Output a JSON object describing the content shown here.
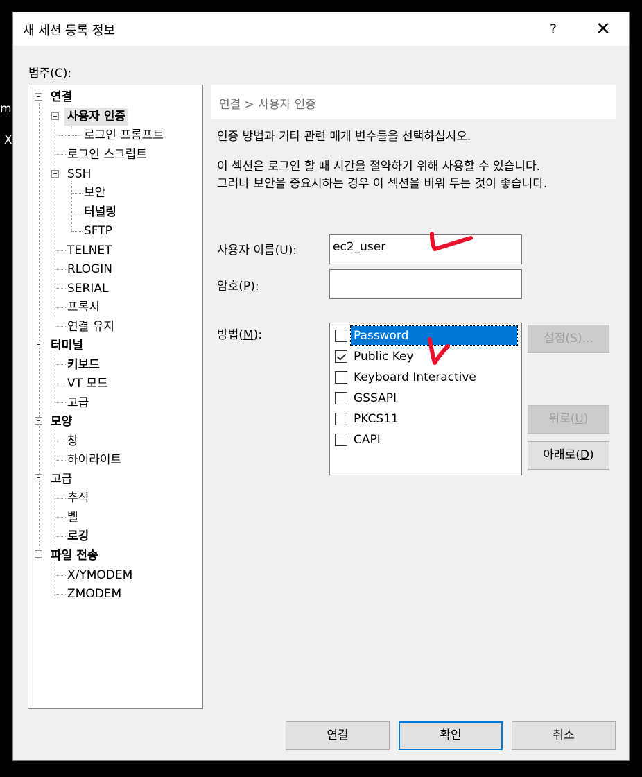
{
  "background": {
    "frag1": "mp",
    "frag2": "X"
  },
  "titlebar": {
    "title": "새 세션 등록 정보",
    "help": "?",
    "close": "✕"
  },
  "category": {
    "label_pre": "범주(",
    "mnemonic": "C",
    "label_post": "):"
  },
  "tree": {
    "connection": "연결",
    "user_auth": "사용자 인증",
    "login_prompt": "로그인 프롬프트",
    "login_script": "로그인 스크립트",
    "ssh": "SSH",
    "security": "보안",
    "tunneling": "터널링",
    "sftp": "SFTP",
    "telnet": "TELNET",
    "rlogin": "RLOGIN",
    "serial": "SERIAL",
    "proxy": "프록시",
    "keepalive": "연결 유지",
    "terminal": "터미널",
    "keyboard": "키보드",
    "vt_mode": "VT 모드",
    "advanced": "고급",
    "appearance": "모양",
    "window": "창",
    "highlight": "하이라이트",
    "advanced2": "고급",
    "trace": "추적",
    "bell": "벨",
    "logging": "로깅",
    "file_transfer": "파일 전송",
    "xymodem": "X/YMODEM",
    "zmodem": "ZMODEM"
  },
  "breadcrumb": "연결 > 사용자 인증",
  "description": {
    "line1": "인증 방법과 기타 관련 매개 변수들을 선택하십시오.",
    "line2": "이 섹션은 로그인 할 때 시간을 절약하기 위해 사용할 수 있습니다.",
    "line3": "그러나 보안을 중요시하는 경우 이 섹션을 비워 두는 것이 좋습니다."
  },
  "username": {
    "label_pre": "사용자 이름(",
    "mnemonic": "U",
    "label_post": "):",
    "value": "ec2_user"
  },
  "password": {
    "label_pre": "암호(",
    "mnemonic": "P",
    "label_post": "):",
    "value": ""
  },
  "method": {
    "label_pre": "방법(",
    "mnemonic": "M",
    "label_post": "):",
    "items": [
      {
        "label": "Password",
        "checked": false,
        "selected": true
      },
      {
        "label": "Public Key",
        "checked": true,
        "selected": false
      },
      {
        "label": "Keyboard Interactive",
        "checked": false,
        "selected": false
      },
      {
        "label": "GSSAPI",
        "checked": false,
        "selected": false
      },
      {
        "label": "PKCS11",
        "checked": false,
        "selected": false
      },
      {
        "label": "CAPI",
        "checked": false,
        "selected": false
      }
    ]
  },
  "side_buttons": {
    "settings_pre": "설정(",
    "settings_mn": "S",
    "settings_post": ")...",
    "up_pre": "위로(",
    "up_mn": "U",
    "up_post": ")",
    "down_pre": "아래로(",
    "down_mn": "D",
    "down_post": ")"
  },
  "footer": {
    "connect": "연결",
    "ok": "확인",
    "cancel": "취소"
  },
  "colors": {
    "accent": "#0078d7",
    "annotation": "#e8102a"
  }
}
